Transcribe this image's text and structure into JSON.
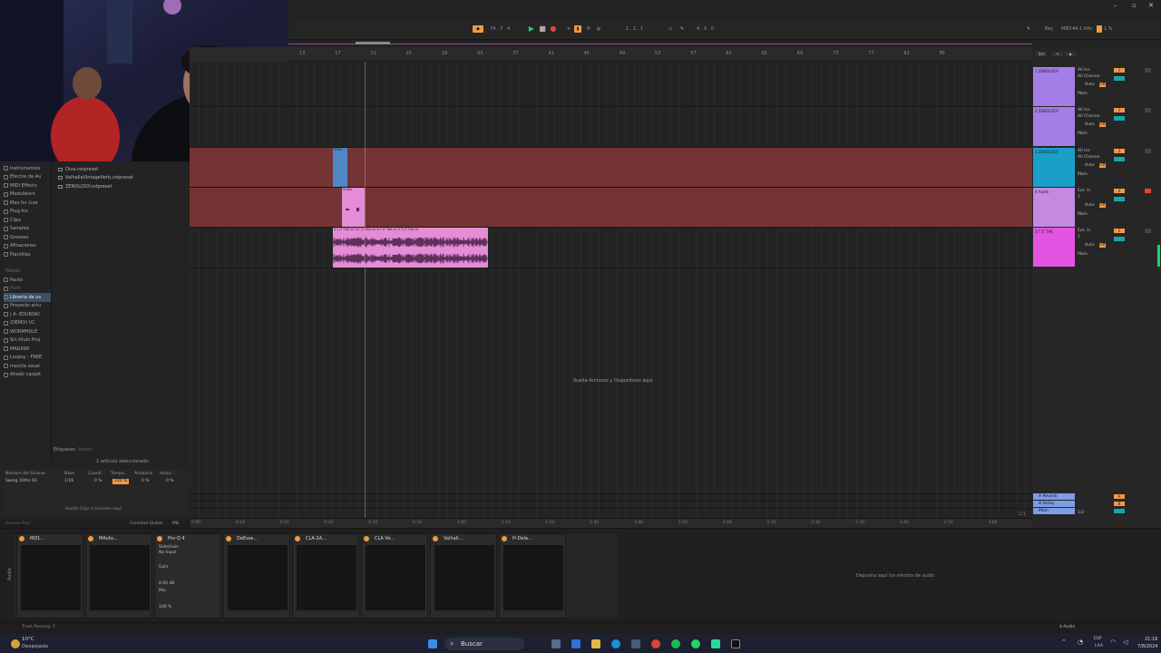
{
  "transport": {
    "tempo_left": "74 . 7 . 4",
    "position": "1 . 1 . 1",
    "loop_position": "4 . 0 . 0",
    "key_label": "Key",
    "midi_label": "MIDI",
    "sample_rate": "44.1 kHz",
    "cpu": "1 %"
  },
  "browser": {
    "categories": [
      {
        "label": "Instrumentos",
        "selected": false
      },
      {
        "label": "Efectos de Au",
        "selected": false
      },
      {
        "label": "MIDI Effects",
        "selected": false
      },
      {
        "label": "Modulators",
        "selected": false
      },
      {
        "label": "Max for Live",
        "selected": false
      },
      {
        "label": "Plug-Ins",
        "selected": false
      },
      {
        "label": "Clips",
        "selected": false
      },
      {
        "label": "Samples",
        "selected": false
      },
      {
        "label": "Grooves",
        "selected": false
      },
      {
        "label": "Afinaciones",
        "selected": false
      },
      {
        "label": "Plantillas",
        "selected": false
      }
    ],
    "places_header": "Places",
    "places": [
      {
        "label": "Packs",
        "selected": false
      },
      {
        "label": "Push",
        "selected": false
      },
      {
        "label": "Librería de us",
        "selected": true
      },
      {
        "label": "Proyecto actu",
        "selected": false
      },
      {
        "label": "| A- EDURDKI",
        "selected": false
      },
      {
        "label": "(DEMO) VC",
        "selected": false
      },
      {
        "label": "WORMHOLE",
        "selected": false
      },
      {
        "label": "Sin título Proj",
        "selected": false
      },
      {
        "label": "MAG999",
        "selected": false
      },
      {
        "label": "Loopsy - FREE",
        "selected": false
      },
      {
        "label": "mezcla vocal",
        "selected": false
      },
      {
        "label": "Añadir carpet",
        "selected": false
      }
    ],
    "files": [
      "Diva.vstpreset",
      "ValhallaVintageVerb.vstpreset",
      "ZENOLOGY.vstpreset"
    ],
    "tags_label": "Etiquetas:",
    "tags_value": "Añadir",
    "selection_count": "1 artículo seleccionado"
  },
  "groove_pool": {
    "headers": [
      "Nombre del Groove",
      "Base",
      "Cuanti...",
      "Tempo...",
      "Aleatorio",
      "Veloci..."
    ],
    "row": [
      "Swing 16ths 66",
      "1/16",
      "0 %",
      "100 %",
      "0 %",
      "0 %"
    ],
    "drop_text": "Suelta Clips o Grooves aquí",
    "global_amount_label": "Cantidad Global",
    "global_amount_value": "0%",
    "pool_label": "Groove Pool"
  },
  "arrangement": {
    "bar_numbers": [
      "13",
      "17",
      "21",
      "25",
      "29",
      "33",
      "37",
      "41",
      "45",
      "49",
      "53",
      "57",
      "61",
      "65",
      "69",
      "73",
      "77",
      "81",
      "85"
    ],
    "time_labels": [
      "0:00",
      "0:10",
      "0:20",
      "0:30",
      "0:40",
      "0:50",
      "1:00",
      "1:10",
      "1:20",
      "1:30",
      "1:40",
      "1:50",
      "2:00",
      "2:10",
      "2:20",
      "2:30",
      "2:40",
      "2:50",
      "3:00"
    ],
    "drop_text": "Suelta Archivos y Dispositivos aquí",
    "zoom": "1/1",
    "clips": [
      {
        "title": "ZENO",
        "color": "#4f86c6"
      },
      {
        "title": "Audio",
        "color": "#e58cd6"
      },
      {
        "title": "5-T JT TAK ch 5-T JT TAK ch 5-T JT TAK ch 5-T JT TAK ch",
        "color": "#e58cd6"
      }
    ]
  },
  "mixer": {
    "tracks": [
      {
        "name": "1 ZENOLOGY",
        "color": "#a57de6",
        "input": "All Ins",
        "channel": "All Channe",
        "monitor": "Auto",
        "monitor_off": "Off",
        "output": "Main",
        "number": "1"
      },
      {
        "name": "2 ZENOLOGY",
        "color": "#a57de6",
        "input": "All Ins",
        "channel": "All Channe",
        "monitor": "Auto",
        "monitor_off": "Off",
        "output": "Main",
        "number": "2"
      },
      {
        "name": "3 ZENOLOGY",
        "color": "#1aa0c8",
        "input": "All Ins",
        "channel": "All Channe",
        "monitor": "Auto",
        "monitor_off": "Off",
        "output": "Main",
        "number": "3"
      },
      {
        "name": "4 Audio",
        "color": "#c38ae0",
        "input": "Ext. In",
        "channel": "1",
        "monitor": "Auto",
        "monitor_off": "Off",
        "output": "Main",
        "number": "4"
      },
      {
        "name": "5-T JT TAK",
        "color": "#e255e2",
        "input": "Ext. In",
        "channel": "2",
        "monitor": "Auto",
        "monitor_off": "Off",
        "output": "Main",
        "number": "5"
      }
    ],
    "returns": [
      {
        "name": "A Reverb",
        "letter": "A"
      },
      {
        "name": "B Delay",
        "letter": "B"
      },
      {
        "name": "Main",
        "letter": "1/2"
      }
    ]
  },
  "devices": {
    "chain": [
      {
        "title": "MD1..."
      },
      {
        "title": "MAuto..."
      },
      {
        "title": "Pro-Q 4"
      },
      {
        "title": "DeEsse..."
      },
      {
        "title": "CLA-2A..."
      },
      {
        "title": "CLA Vo..."
      },
      {
        "title": "Valhall..."
      },
      {
        "title": "H-Dela..."
      }
    ],
    "sidechain_label": "Sidechain",
    "sidechain_value": "No Input",
    "gain_label": "Gain",
    "gain_value": "0.00 dB",
    "mix_label": "Mix",
    "mix_value": "100 %",
    "audio_fx_drop": "Deposita aquí los efectos de audio",
    "vertical_label": "Audio"
  },
  "status": {
    "text": "Track Panning: C",
    "track": "4-Audio"
  },
  "taskbar": {
    "search": "Buscar",
    "weather_temp": "10°C",
    "weather_desc": "Despejado",
    "lang1": "ESP",
    "lang2": "LAA",
    "time": "21:16",
    "date": "7/8/2024"
  }
}
